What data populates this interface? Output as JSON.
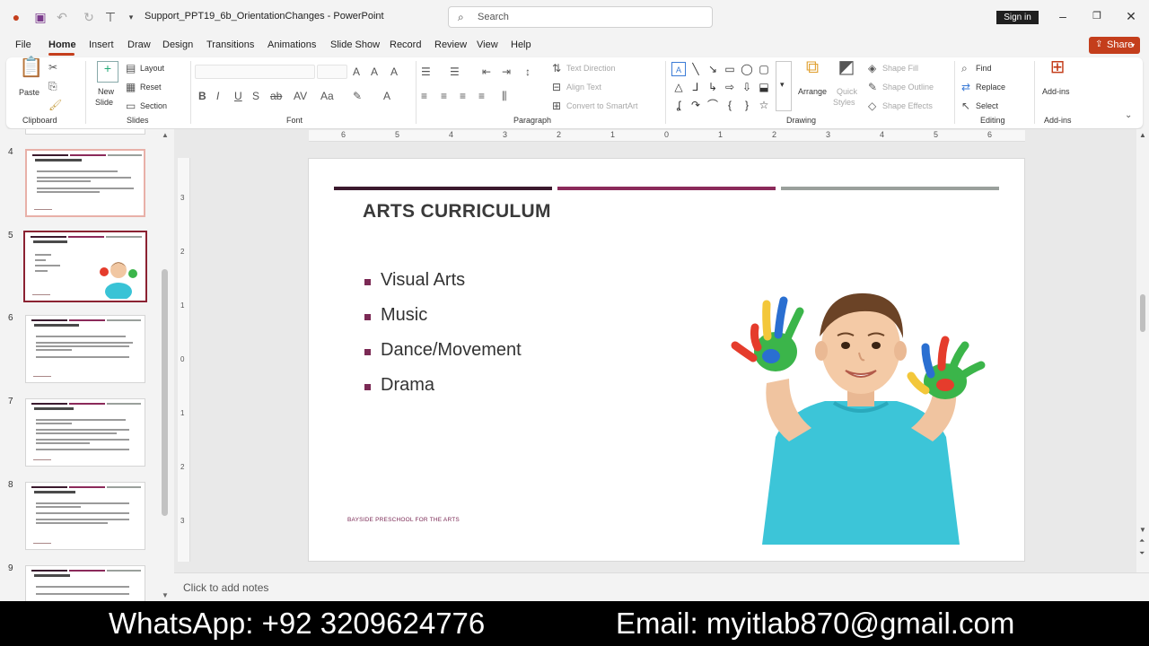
{
  "titlebar": {
    "doc_title": "Support_PPT19_6b_OrientationChanges  -  PowerPoint",
    "search_placeholder": "Search",
    "signin_label": "Sign in"
  },
  "menu": {
    "tabs": [
      "File",
      "Home",
      "Insert",
      "Draw",
      "Design",
      "Transitions",
      "Animations",
      "Slide Show",
      "Record",
      "Review",
      "View",
      "Help"
    ],
    "active": "Home",
    "share_label": "Share"
  },
  "ribbon": {
    "clipboard": {
      "group": "Clipboard",
      "paste": "Paste"
    },
    "slides": {
      "group": "Slides",
      "new_slide": "New",
      "new_slide2": "Slide",
      "layout": "Layout",
      "reset": "Reset",
      "section": "Section"
    },
    "font": {
      "group": "Font"
    },
    "paragraph": {
      "group": "Paragraph",
      "text_direction": "Text Direction",
      "align_text": "Align Text",
      "convert_smartart": "Convert to SmartArt"
    },
    "drawing": {
      "group": "Drawing",
      "arrange": "Arrange",
      "quick_styles": "Quick",
      "quick_styles2": "Styles",
      "shape_fill": "Shape Fill",
      "shape_outline": "Shape Outline",
      "shape_effects": "Shape Effects"
    },
    "editing": {
      "group": "Editing",
      "find": "Find",
      "replace": "Replace",
      "select": "Select"
    },
    "addins": {
      "group": "Add-ins",
      "label": "Add-ins"
    }
  },
  "thumbnails": {
    "numbers": [
      "4",
      "5",
      "6",
      "7",
      "8",
      "9"
    ],
    "selected": "5"
  },
  "ruler": {
    "h": [
      "6",
      "5",
      "4",
      "3",
      "2",
      "1",
      "0",
      "1",
      "2",
      "3",
      "4",
      "5",
      "6"
    ],
    "v": [
      "3",
      "2",
      "1",
      "0",
      "1",
      "2",
      "3"
    ]
  },
  "slide": {
    "title": "ARTS CURRICULUM",
    "bullets": [
      "Visual Arts",
      "Music",
      "Dance/Movement",
      "Drama"
    ],
    "footer": "BAYSIDE PRESCHOOL FOR THE ARTS",
    "bar_colors": [
      "#3b1a2e",
      "#8b2a5a",
      "#9aa09c"
    ],
    "bullet_color": "#7b2a55"
  },
  "notes": {
    "placeholder": "Click to add notes"
  },
  "banner": {
    "whatsapp": "WhatsApp: +92 3209624776",
    "email": "Email: myitlab870@gmail.com"
  }
}
